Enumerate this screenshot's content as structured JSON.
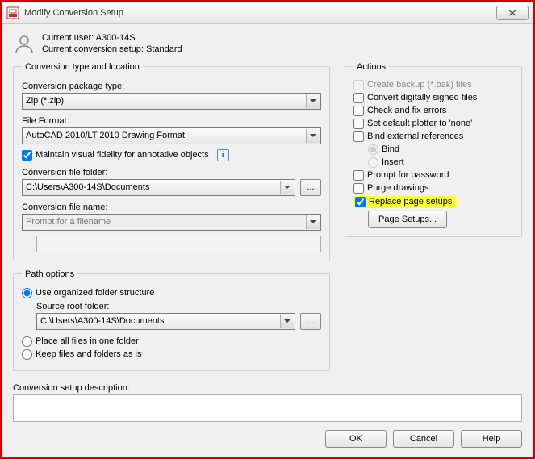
{
  "window": {
    "title": "Modify Conversion Setup"
  },
  "user": {
    "current_user_label": "Current user: A300-14S",
    "current_setup_label": "Current conversion setup: Standard"
  },
  "type_loc": {
    "legend": "Conversion type and location",
    "pkg_label": "Conversion package type:",
    "pkg_value": "Zip (*.zip)",
    "fmt_label": "File Format:",
    "fmt_value": "AutoCAD 2010/LT 2010 Drawing Format",
    "fidelity_label": "Maintain visual fidelity for annotative objects",
    "folder_label": "Conversion file folder:",
    "folder_value": "C:\\Users\\A300-14S\\Documents",
    "name_label": "Conversion file name:",
    "name_value": "Prompt for a filename",
    "name_text": ""
  },
  "path": {
    "legend": "Path options",
    "opt_org": "Use organized folder structure",
    "src_label": "Source root folder:",
    "src_value": "C:\\Users\\A300-14S\\Documents",
    "opt_one": "Place all files in one folder",
    "opt_keep": "Keep files and folders as is"
  },
  "actions": {
    "legend": "Actions",
    "backup": "Create backup (*.bak) files",
    "digital": "Convert digitally signed files",
    "checkfix": "Check and fix errors",
    "plotter": "Set default plotter to 'none'",
    "bindext": "Bind external references",
    "bind": "Bind",
    "insert": "Insert",
    "prompt_pw": "Prompt for password",
    "purge": "Purge drawings",
    "replace": "Replace page setups",
    "page_setups_btn": "Page Setups..."
  },
  "desc": {
    "label": "Conversion setup description:"
  },
  "buttons": {
    "ok": "OK",
    "cancel": "Cancel",
    "help": "Help",
    "browse": "..."
  }
}
